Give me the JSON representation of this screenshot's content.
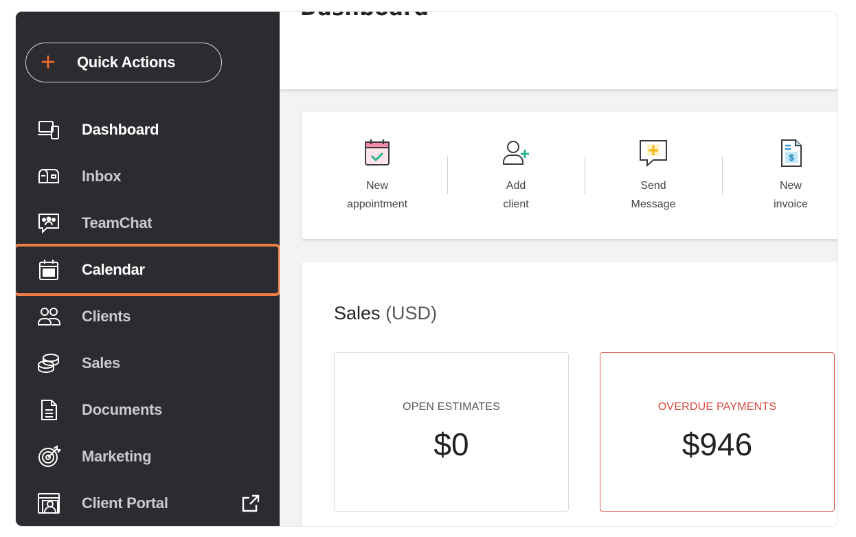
{
  "sidebar": {
    "quick_actions_label": "Quick Actions",
    "items": [
      {
        "label": "Dashboard",
        "icon": "devices-icon"
      },
      {
        "label": "Inbox",
        "icon": "mailbox-icon"
      },
      {
        "label": "TeamChat",
        "icon": "team-chat-icon"
      },
      {
        "label": "Calendar",
        "icon": "calendar-icon"
      },
      {
        "label": "Clients",
        "icon": "clients-icon"
      },
      {
        "label": "Sales",
        "icon": "coins-icon"
      },
      {
        "label": "Documents",
        "icon": "document-icon"
      },
      {
        "label": "Marketing",
        "icon": "target-icon"
      },
      {
        "label": "Client Portal",
        "icon": "portal-icon"
      }
    ],
    "accent": "#f26b2b",
    "highlight": "#ef7d45"
  },
  "header": {
    "title": "Dashboard"
  },
  "quick_links": [
    {
      "line1": "New",
      "line2": "appointment",
      "icon": "new-appointment-icon"
    },
    {
      "line1": "Add",
      "line2": "client",
      "icon": "add-client-icon"
    },
    {
      "line1": "Send",
      "line2": "Message",
      "icon": "send-message-icon"
    },
    {
      "line1": "New",
      "line2": "invoice",
      "icon": "new-invoice-icon"
    }
  ],
  "sales": {
    "title": "Sales",
    "unit": "(USD)",
    "open_estimates_label": "OPEN ESTIMATES",
    "open_estimates_value": "$0",
    "overdue_label": "OVERDUE PAYMENTS",
    "overdue_value": "$946",
    "overdue_color": "#d8473b"
  }
}
